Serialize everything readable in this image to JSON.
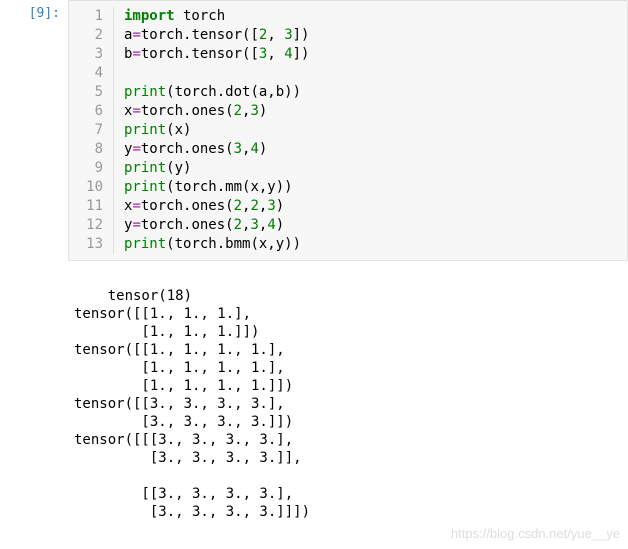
{
  "prompt": "[9]:",
  "code": {
    "line_numbers": [
      "1",
      "2",
      "3",
      "4",
      "5",
      "6",
      "7",
      "8",
      "9",
      "10",
      "11",
      "12",
      "13"
    ],
    "lines": [
      {
        "tokens": [
          {
            "t": "import",
            "c": "kw"
          },
          {
            "t": " torch",
            "c": ""
          }
        ]
      },
      {
        "tokens": [
          {
            "t": "a",
            "c": ""
          },
          {
            "t": "=",
            "c": "op"
          },
          {
            "t": "torch.tensor([",
            "c": ""
          },
          {
            "t": "2",
            "c": "num"
          },
          {
            "t": ", ",
            "c": ""
          },
          {
            "t": "3",
            "c": "num"
          },
          {
            "t": "])",
            "c": ""
          }
        ]
      },
      {
        "tokens": [
          {
            "t": "b",
            "c": ""
          },
          {
            "t": "=",
            "c": "op"
          },
          {
            "t": "torch.tensor([",
            "c": ""
          },
          {
            "t": "3",
            "c": "num"
          },
          {
            "t": ", ",
            "c": ""
          },
          {
            "t": "4",
            "c": "num"
          },
          {
            "t": "])",
            "c": ""
          }
        ]
      },
      {
        "tokens": [
          {
            "t": "",
            "c": ""
          }
        ]
      },
      {
        "tokens": [
          {
            "t": "print",
            "c": "fn"
          },
          {
            "t": "(torch.dot(a,b))",
            "c": ""
          }
        ]
      },
      {
        "tokens": [
          {
            "t": "x",
            "c": ""
          },
          {
            "t": "=",
            "c": "op"
          },
          {
            "t": "torch.ones(",
            "c": ""
          },
          {
            "t": "2",
            "c": "num"
          },
          {
            "t": ",",
            "c": ""
          },
          {
            "t": "3",
            "c": "num"
          },
          {
            "t": ")",
            "c": ""
          }
        ]
      },
      {
        "tokens": [
          {
            "t": "print",
            "c": "fn"
          },
          {
            "t": "(x)",
            "c": ""
          }
        ]
      },
      {
        "tokens": [
          {
            "t": "y",
            "c": ""
          },
          {
            "t": "=",
            "c": "op"
          },
          {
            "t": "torch.ones(",
            "c": ""
          },
          {
            "t": "3",
            "c": "num"
          },
          {
            "t": ",",
            "c": ""
          },
          {
            "t": "4",
            "c": "num"
          },
          {
            "t": ")",
            "c": ""
          }
        ]
      },
      {
        "tokens": [
          {
            "t": "print",
            "c": "fn"
          },
          {
            "t": "(y)",
            "c": ""
          }
        ]
      },
      {
        "tokens": [
          {
            "t": "print",
            "c": "fn"
          },
          {
            "t": "(torch.mm(x,y))",
            "c": ""
          }
        ]
      },
      {
        "tokens": [
          {
            "t": "x",
            "c": ""
          },
          {
            "t": "=",
            "c": "op"
          },
          {
            "t": "torch.ones(",
            "c": ""
          },
          {
            "t": "2",
            "c": "num"
          },
          {
            "t": ",",
            "c": ""
          },
          {
            "t": "2",
            "c": "num"
          },
          {
            "t": ",",
            "c": ""
          },
          {
            "t": "3",
            "c": "num"
          },
          {
            "t": ")",
            "c": ""
          }
        ]
      },
      {
        "tokens": [
          {
            "t": "y",
            "c": ""
          },
          {
            "t": "=",
            "c": "op"
          },
          {
            "t": "torch.ones(",
            "c": ""
          },
          {
            "t": "2",
            "c": "num"
          },
          {
            "t": ",",
            "c": ""
          },
          {
            "t": "3",
            "c": "num"
          },
          {
            "t": ",",
            "c": ""
          },
          {
            "t": "4",
            "c": "num"
          },
          {
            "t": ")",
            "c": ""
          }
        ]
      },
      {
        "tokens": [
          {
            "t": "print",
            "c": "fn"
          },
          {
            "t": "(torch.bmm(x,y))",
            "c": ""
          }
        ]
      }
    ]
  },
  "output_lines": [
    "tensor(18)",
    "tensor([[1., 1., 1.],",
    "        [1., 1., 1.]])",
    "tensor([[1., 1., 1., 1.],",
    "        [1., 1., 1., 1.],",
    "        [1., 1., 1., 1.]])",
    "tensor([[3., 3., 3., 3.],",
    "        [3., 3., 3., 3.]])",
    "tensor([[[3., 3., 3., 3.],",
    "         [3., 3., 3., 3.]],",
    "",
    "        [[3., 3., 3., 3.],",
    "         [3., 3., 3., 3.]]])"
  ],
  "watermark": "https://blog.csdn.net/yue__ye"
}
